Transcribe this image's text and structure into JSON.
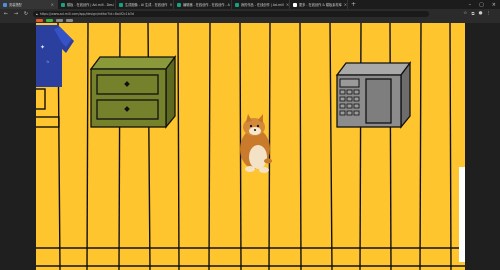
{
  "browser": {
    "tabs": [
      {
        "label": "男装搭配",
        "active": true,
        "color": "#4a90e2"
      },
      {
        "label": "模板 - 在线创作 | Ad-mill - Desi",
        "active": false,
        "color": "#16a085"
      },
      {
        "label": "生成图像 - AI 生成 - 在线创作",
        "active": false,
        "color": "#16a085"
      },
      {
        "label": "编辑器 - 在线创作 - 在线创作 - A",
        "active": false,
        "color": "#16a085"
      },
      {
        "label": "我的作品 - 在线创作 | Ad-mill",
        "active": false,
        "color": "#16a085"
      },
      {
        "label": "更多 - 在线创作 & 模板素材库",
        "active": false,
        "color": "#ffffff"
      }
    ],
    "new_tab_label": "+",
    "url": "https://www.ad-mill.com/app/design/editor?id=8a4f2c1b3d",
    "bookmark_colors": [
      "#e05a2b",
      "#3bb34a",
      "#888888",
      "#888888"
    ]
  },
  "scene": {
    "background_color": "#ffc52e",
    "line_color": "#111111",
    "objects": [
      {
        "name": "blue-tshirt-image"
      },
      {
        "name": "green-dresser"
      },
      {
        "name": "shiba-dog-sticker"
      },
      {
        "name": "microwave-oven"
      }
    ]
  }
}
